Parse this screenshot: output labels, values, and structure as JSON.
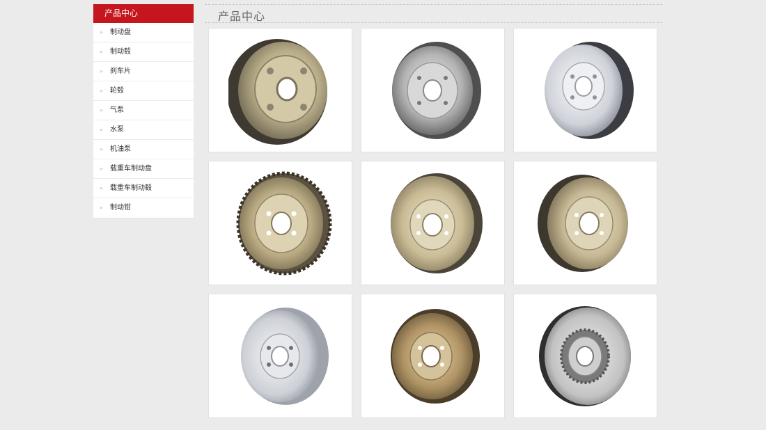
{
  "sidebar": {
    "header": "产品中心",
    "bullet": "»",
    "items": [
      {
        "label": "制动盘"
      },
      {
        "label": "制动毂"
      },
      {
        "label": "刹车片"
      },
      {
        "label": "轮毂"
      },
      {
        "label": "气泵"
      },
      {
        "label": "水泵"
      },
      {
        "label": "机油泵"
      },
      {
        "label": "载重车制动盘"
      },
      {
        "label": "载重车制动毂"
      },
      {
        "label": "制动钳"
      }
    ]
  },
  "main": {
    "title": "产品中心"
  },
  "products": [
    {
      "icon": "brake-drum-studs-icon",
      "color": "#b9ad8c"
    },
    {
      "icon": "brake-drum-silver-icon",
      "color": "#b8b8b8"
    },
    {
      "icon": "brake-drum-silver-icon",
      "color": "#d2d4da"
    },
    {
      "icon": "brake-drum-toothed-icon",
      "color": "#c2b48e"
    },
    {
      "icon": "brake-drum-gold-icon",
      "color": "#cdbf9b"
    },
    {
      "icon": "brake-drum-gold-icon",
      "color": "#c9bc98"
    },
    {
      "icon": "brake-drum-silver-icon",
      "color": "#cfd1d6"
    },
    {
      "icon": "brake-drum-bronze-icon",
      "color": "#b09465"
    },
    {
      "icon": "brake-disc-vented-icon",
      "color": "#bcbcbc"
    }
  ]
}
